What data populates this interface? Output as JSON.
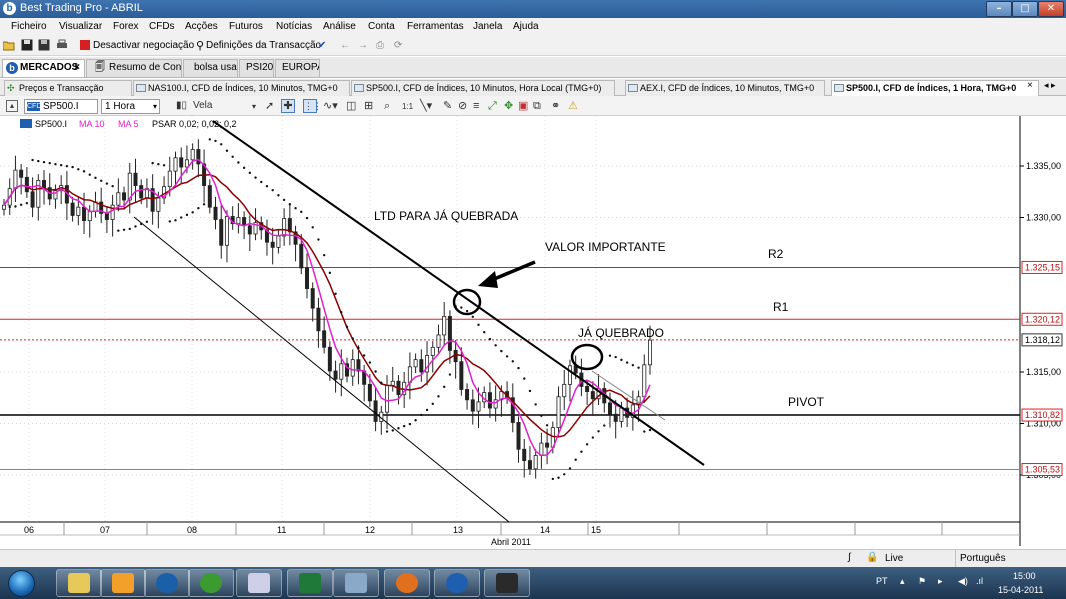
{
  "window": {
    "title": "Best Trading Pro - ABRIL"
  },
  "menu": [
    "Ficheiro",
    "Visualizar",
    "Forex",
    "CFDs",
    "Acções",
    "Futuros",
    "Notícias",
    "Análise",
    "Conta",
    "Ferramentas",
    "Janela",
    "Ajuda"
  ],
  "toolbar": {
    "deactivate_label": "Desactivar negociação",
    "settings_label": "Definições da Transacção"
  },
  "top_tabs": [
    {
      "label": "MERCADOS",
      "close": "×"
    },
    {
      "label": "Resumo de Conta"
    },
    {
      "label": "bolsa usa"
    },
    {
      "label": "PSI20"
    },
    {
      "label": "EUROPA"
    }
  ],
  "chart_tabs": [
    {
      "label": "Preços e Transacção"
    },
    {
      "label": "NAS100.I, CFD de Índices, 10 Minutos, TMG+0"
    },
    {
      "label": "SP500.I, CFD de Índices, 10 Minutos, Hora Local (TMG+0)"
    },
    {
      "label": "AEX.I, CFD de Índices, 10 Minutos, TMG+0"
    },
    {
      "label": "SP500.I, CFD de Índices, 1 Hora, TMG+0",
      "close": "×"
    }
  ],
  "chart_toolbar": {
    "symbol": "SP500.I",
    "timeframe": "1 Hora",
    "chart_type": "Vela"
  },
  "legend": {
    "symbol": "SP500.I",
    "ma10": "MA 10",
    "ma5": "MA 5",
    "psar": "PSAR 0,02; 0,02; 0,2"
  },
  "colors": {
    "r_lines": "#e02020",
    "pivot": "#000000",
    "support": "#22cc22",
    "ma10": "#8b0000",
    "ma5": "#e020d0"
  },
  "chart_data": {
    "type": "candlestick",
    "price_ticks": [
      "1.335,00",
      "1.330,00",
      "1.315,00",
      "1.310,00",
      "1.305,00"
    ],
    "day_ticks": [
      "06",
      "07",
      "08",
      "11",
      "12",
      "13",
      "14",
      "15"
    ],
    "month_label": "Abril 2011",
    "levels": [
      {
        "name": "R2",
        "value": "1.325,15"
      },
      {
        "name": "R1",
        "value": "1.320,12"
      },
      {
        "name": "last",
        "value": "1.318,12"
      },
      {
        "name": "PIVOT",
        "value": "1.310,82"
      },
      {
        "name": "support",
        "value": "1.305,53"
      }
    ],
    "annotations": [
      "LTD PARA JÁ QUEBRADA",
      "VALOR IMPORTANTE",
      "JÁ QUEBRADO",
      "R2",
      "R1",
      "PIVOT"
    ],
    "closes": [
      1331.2,
      1332.8,
      1334.6,
      1333.9,
      1332.5,
      1331.0,
      1333.6,
      1332.9,
      1331.8,
      1332.6,
      1333.1,
      1331.4,
      1330.2,
      1331.0,
      1329.7,
      1330.6,
      1331.5,
      1330.4,
      1329.8,
      1331.2,
      1332.4,
      1331.7,
      1334.3,
      1333.1,
      1331.9,
      1332.8,
      1330.6,
      1331.9,
      1333.0,
      1334.5,
      1335.8,
      1334.9,
      1335.6,
      1336.6,
      1335.2,
      1333.1,
      1331.0,
      1329.8,
      1327.3,
      1330.1,
      1329.4,
      1330.0,
      1329.2,
      1328.4,
      1329.5,
      1328.8,
      1327.6,
      1327.1,
      1328.2,
      1329.9,
      1328.6,
      1327.4,
      1325.1,
      1323.1,
      1321.2,
      1319.0,
      1317.4,
      1315.1,
      1314.3,
      1315.8,
      1314.6,
      1316.2,
      1315.1,
      1313.8,
      1312.2,
      1310.2,
      1311.1,
      1313.7,
      1314.1,
      1312.8,
      1314.0,
      1315.5,
      1316.2,
      1315.0,
      1316.6,
      1317.4,
      1318.6,
      1320.4,
      1317.1,
      1316.0,
      1313.3,
      1312.3,
      1311.2,
      1312.1,
      1313.0,
      1311.5,
      1312.3,
      1313.1,
      1312.5,
      1310.1,
      1307.5,
      1306.4,
      1305.6,
      1306.9,
      1308.1,
      1307.7,
      1309.6,
      1312.6,
      1313.8,
      1315.6,
      1314.9,
      1313.6,
      1313.1,
      1312.4,
      1313.4,
      1312.0,
      1310.9,
      1310.2,
      1311.5,
      1310.6,
      1311.8,
      1312.6,
      1315.7,
      1318.1
    ]
  },
  "status": {
    "connection": "Live",
    "language": "Português"
  },
  "taskbar": {
    "lang": "PT",
    "time": "15:00",
    "date": "15-04-2011"
  }
}
